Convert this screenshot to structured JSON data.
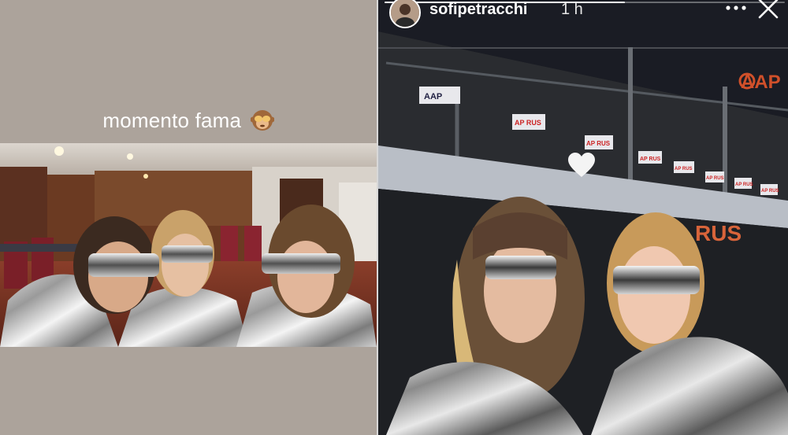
{
  "left_story": {
    "caption": "momento fama",
    "caption_emoji": "see-no-evil-monkey-icon"
  },
  "right_story": {
    "username": "sofipetracchi",
    "time": "1 h",
    "progress": 0.6,
    "signs": [
      "AAP",
      "AAP",
      "AP RUS",
      "AP RUS",
      "AP RUS",
      "AP RUS",
      "AP RUS",
      "AP RUS",
      "RUS"
    ],
    "heart_icon": "heart-icon",
    "more_icon": "more-dots-icon",
    "close_icon": "close-icon"
  },
  "colors": {
    "left_background": "#aca39b",
    "caption_text": "#ffffff"
  }
}
